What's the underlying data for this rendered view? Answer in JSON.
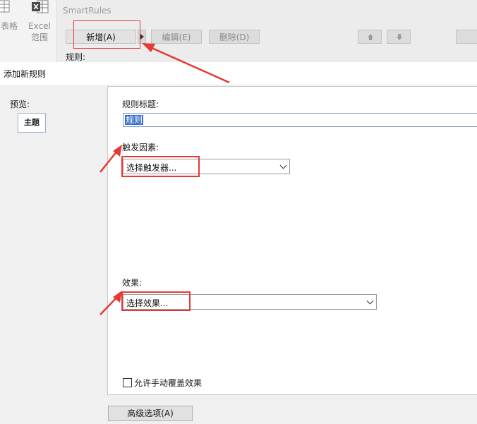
{
  "ribbon": {
    "table_label": "表格",
    "excel_label_line1": "Excel",
    "excel_label_line2": "范围",
    "smartrules_title": "SmartRules",
    "add_button": "新增(A)",
    "edit_button": "编辑(E)",
    "delete_button": "删除(D)",
    "rules_label": "规则:"
  },
  "dialog": {
    "title": "添加新规则",
    "preview_label": "预览:",
    "topic_label": "主题",
    "rule_title_label": "规则标题:",
    "rule_title_value": "规则",
    "trigger_label": "触发因素:",
    "trigger_select": "选择触发器...",
    "effect_label": "效果:",
    "effect_select": "选择效果...",
    "override_checkbox_label": "允许手动覆盖效果",
    "advanced_button": "高级选项(A)"
  },
  "colors": {
    "annotation_red": "#e53935",
    "selection_blue": "#3a6ec8",
    "excel_green": "#1d6f42"
  },
  "icons": [
    "table-icon",
    "excel-icon",
    "arrow-up-icon",
    "arrow-down-icon",
    "chevron-down-icon"
  ]
}
